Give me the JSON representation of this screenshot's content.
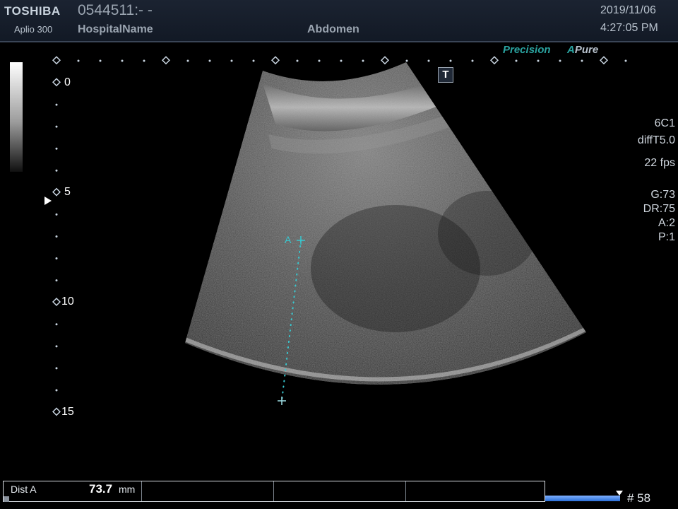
{
  "header": {
    "brand": "TOSHIBA",
    "model": "Aplio 300",
    "patient_id": "0544511:- -",
    "hospital": "HospitalName",
    "exam": "Abdomen",
    "date": "2019/11/06",
    "time": "4:27:05 PM"
  },
  "modes": {
    "precision": "Precision",
    "apure_a": "A",
    "apure_rest": "Pure"
  },
  "t_badge": "T",
  "parameters": {
    "probe": "6C1",
    "preset": "diffT5.0",
    "fps": "22 fps",
    "gain": "G:73",
    "dynamic_range": "DR:75",
    "a": "A:2",
    "p": "P:1"
  },
  "depth_scale": {
    "labels": [
      "0",
      "5",
      "10",
      "15"
    ],
    "unit_values": [
      0,
      5,
      10,
      15
    ]
  },
  "measurement": {
    "caliper_label": "A",
    "dist_label": "Dist A",
    "dist_value": "73.7",
    "dist_unit": "mm"
  },
  "cine": {
    "frame": "# 58"
  },
  "colors": {
    "caliper": "#37c8d0",
    "accent_teal": "#2aa3a0",
    "header_bg": "#1b2331"
  }
}
